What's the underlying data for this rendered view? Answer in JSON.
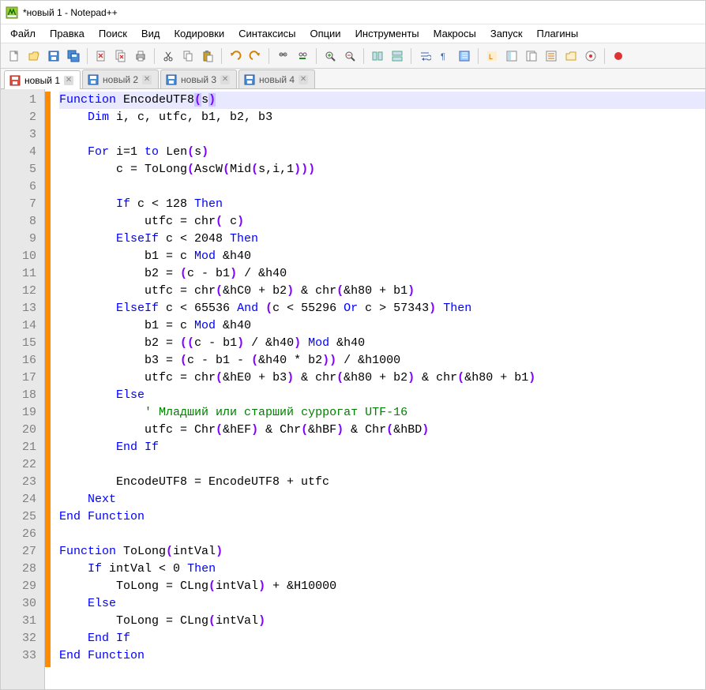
{
  "window": {
    "title": "*новый 1 - Notepad++"
  },
  "menu": {
    "file": "Файл",
    "edit": "Правка",
    "search": "Поиск",
    "view": "Вид",
    "encoding": "Кодировки",
    "syntax": "Синтаксисы",
    "options": "Опции",
    "tools": "Инструменты",
    "macros": "Макросы",
    "run": "Запуск",
    "plugins": "Плагины"
  },
  "tabs": [
    {
      "label": "новый 1",
      "active": true,
      "modified": true
    },
    {
      "label": "новый 2",
      "active": false,
      "modified": false
    },
    {
      "label": "новый 3",
      "active": false,
      "modified": false
    },
    {
      "label": "новый 4",
      "active": false,
      "modified": false
    }
  ],
  "code": {
    "lines": [
      "Function EncodeUTF8(s)",
      "    Dim i, c, utfc, b1, b2, b3",
      "",
      "    For i=1 to Len(s)",
      "        c = ToLong(AscW(Mid(s,i,1)))",
      "",
      "        If c < 128 Then",
      "            utfc = chr( c)",
      "        ElseIf c < 2048 Then",
      "            b1 = c Mod &h40",
      "            b2 = (c - b1) / &h40",
      "            utfc = chr(&hC0 + b2) & chr(&h80 + b1)",
      "        ElseIf c < 65536 And (c < 55296 Or c > 57343) Then",
      "            b1 = c Mod &h40",
      "            b2 = ((c - b1) / &h40) Mod &h40",
      "            b3 = (c - b1 - (&h40 * b2)) / &h1000",
      "            utfc = chr(&hE0 + b3) & chr(&h80 + b2) & chr(&h80 + b1)",
      "        Else",
      "            ' Младший или старший суррогат UTF-16",
      "            utfc = Chr(&hEF) & Chr(&hBF) & Chr(&hBD)",
      "        End If",
      "",
      "        EncodeUTF8 = EncodeUTF8 + utfc",
      "    Next",
      "End Function",
      "",
      "Function ToLong(intVal)",
      "    If intVal < 0 Then",
      "        ToLong = CLng(intVal) + &H10000",
      "    Else",
      "        ToLong = CLng(intVal)",
      "    End If",
      "End Function"
    ]
  }
}
